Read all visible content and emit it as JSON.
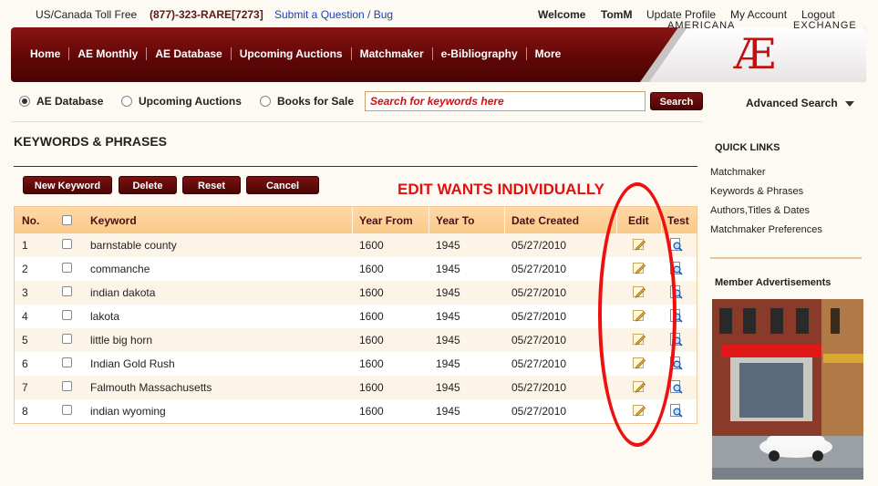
{
  "topbar": {
    "toll_label": "US/Canada Toll Free",
    "phone": "(877)-323-RARE[7273]",
    "submit_link": "Submit a Question / Bug",
    "welcome": "Welcome",
    "username": "TomM",
    "update_profile": "Update Profile",
    "my_account": "My Account",
    "logout": "Logout"
  },
  "nav": {
    "items": [
      "Home",
      "AE Monthly",
      "AE Database",
      "Upcoming Auctions",
      "Matchmaker",
      "e-Bibliography",
      "More"
    ],
    "logo_left": "AMERICANA",
    "logo_mark": "Æ",
    "logo_right": "EXCHANGE"
  },
  "search": {
    "options": [
      {
        "label": "AE Database",
        "selected": true
      },
      {
        "label": "Upcoming Auctions",
        "selected": false
      },
      {
        "label": "Books for Sale",
        "selected": false
      }
    ],
    "placeholder": "Search for keywords here",
    "button": "Search",
    "advanced": "Advanced Search"
  },
  "page": {
    "title": "KEYWORDS & PHRASES",
    "buttons": {
      "new_keyword": "New Keyword",
      "delete": "Delete",
      "reset": "Reset",
      "cancel": "Cancel"
    },
    "annotation": "EDIT WANTS INDIVIDUALLY"
  },
  "table": {
    "headers": {
      "no": "No.",
      "keyword": "Keyword",
      "year_from": "Year From",
      "year_to": "Year To",
      "date_created": "Date Created",
      "edit": "Edit",
      "test": "Test"
    },
    "rows": [
      {
        "no": "1",
        "keyword": "barnstable county",
        "year_from": "1600",
        "year_to": "1945",
        "date": "05/27/2010"
      },
      {
        "no": "2",
        "keyword": "commanche",
        "year_from": "1600",
        "year_to": "1945",
        "date": "05/27/2010"
      },
      {
        "no": "3",
        "keyword": "indian dakota",
        "year_from": "1600",
        "year_to": "1945",
        "date": "05/27/2010"
      },
      {
        "no": "4",
        "keyword": "lakota",
        "year_from": "1600",
        "year_to": "1945",
        "date": "05/27/2010"
      },
      {
        "no": "5",
        "keyword": "little big horn",
        "year_from": "1600",
        "year_to": "1945",
        "date": "05/27/2010"
      },
      {
        "no": "6",
        "keyword": "Indian Gold Rush",
        "year_from": "1600",
        "year_to": "1945",
        "date": "05/27/2010"
      },
      {
        "no": "7",
        "keyword": "Falmouth Massachusetts",
        "year_from": "1600",
        "year_to": "1945",
        "date": "05/27/2010"
      },
      {
        "no": "8",
        "keyword": "indian wyoming",
        "year_from": "1600",
        "year_to": "1945",
        "date": "05/27/2010"
      }
    ]
  },
  "sidebar": {
    "quick_links_title": "QUICK LINKS",
    "quick_links": [
      "Matchmaker",
      "Keywords & Phrases",
      "Authors,Titles & Dates",
      "Matchmaker Preferences"
    ],
    "member_ads_title": "Member Advertisements"
  },
  "colors": {
    "brand": "#6a0a0a",
    "accent_red": "#e01010",
    "header_row": "#f9c98a"
  }
}
